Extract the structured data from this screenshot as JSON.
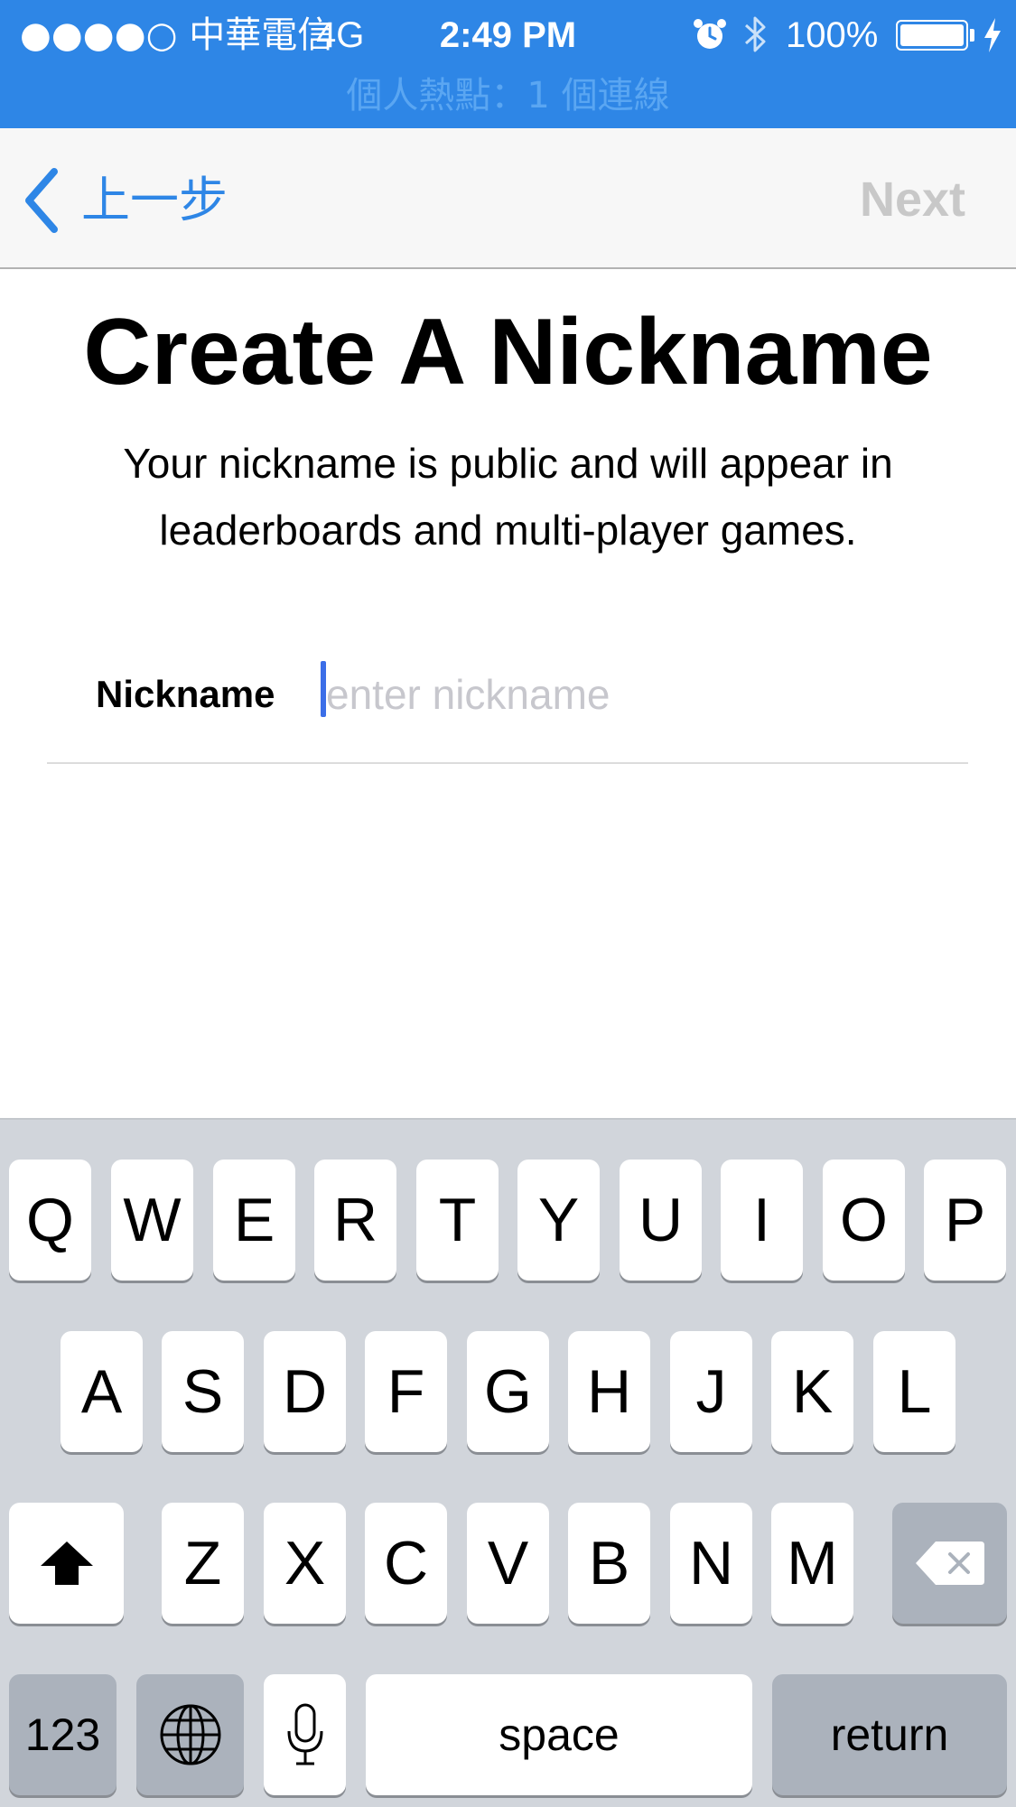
{
  "status_bar": {
    "carrier": "●●●●○ 中華電信",
    "network": "4G",
    "time": "2:49 PM",
    "battery_percent": "100%",
    "hotspot": "個人熱點：1 個連線",
    "icons": [
      "alarm-icon",
      "bluetooth-icon",
      "battery-icon",
      "charging-icon"
    ]
  },
  "nav": {
    "back_label": "上一步",
    "next_label": "Next"
  },
  "page": {
    "title": "Create A Nickname",
    "description": "Your nickname is public and will appear in leaderboards and multi-player games."
  },
  "form": {
    "nickname_label": "Nickname",
    "nickname_value": "",
    "nickname_placeholder": "enter nickname"
  },
  "keyboard": {
    "row1": [
      "Q",
      "W",
      "E",
      "R",
      "T",
      "Y",
      "U",
      "I",
      "O",
      "P"
    ],
    "row2": [
      "A",
      "S",
      "D",
      "F",
      "G",
      "H",
      "J",
      "K",
      "L"
    ],
    "row3": [
      "Z",
      "X",
      "C",
      "V",
      "B",
      "N",
      "M"
    ],
    "numbers_label": "123",
    "space_label": "space",
    "return_label": "return",
    "icons": [
      "shift-icon",
      "delete-icon",
      "globe-icon",
      "microphone-icon"
    ]
  },
  "colors": {
    "status_bar": "#2e86e6",
    "accent": "#2e86e6",
    "next_disabled": "#c8c8c8",
    "keyboard_bg": "#d1d5db"
  }
}
